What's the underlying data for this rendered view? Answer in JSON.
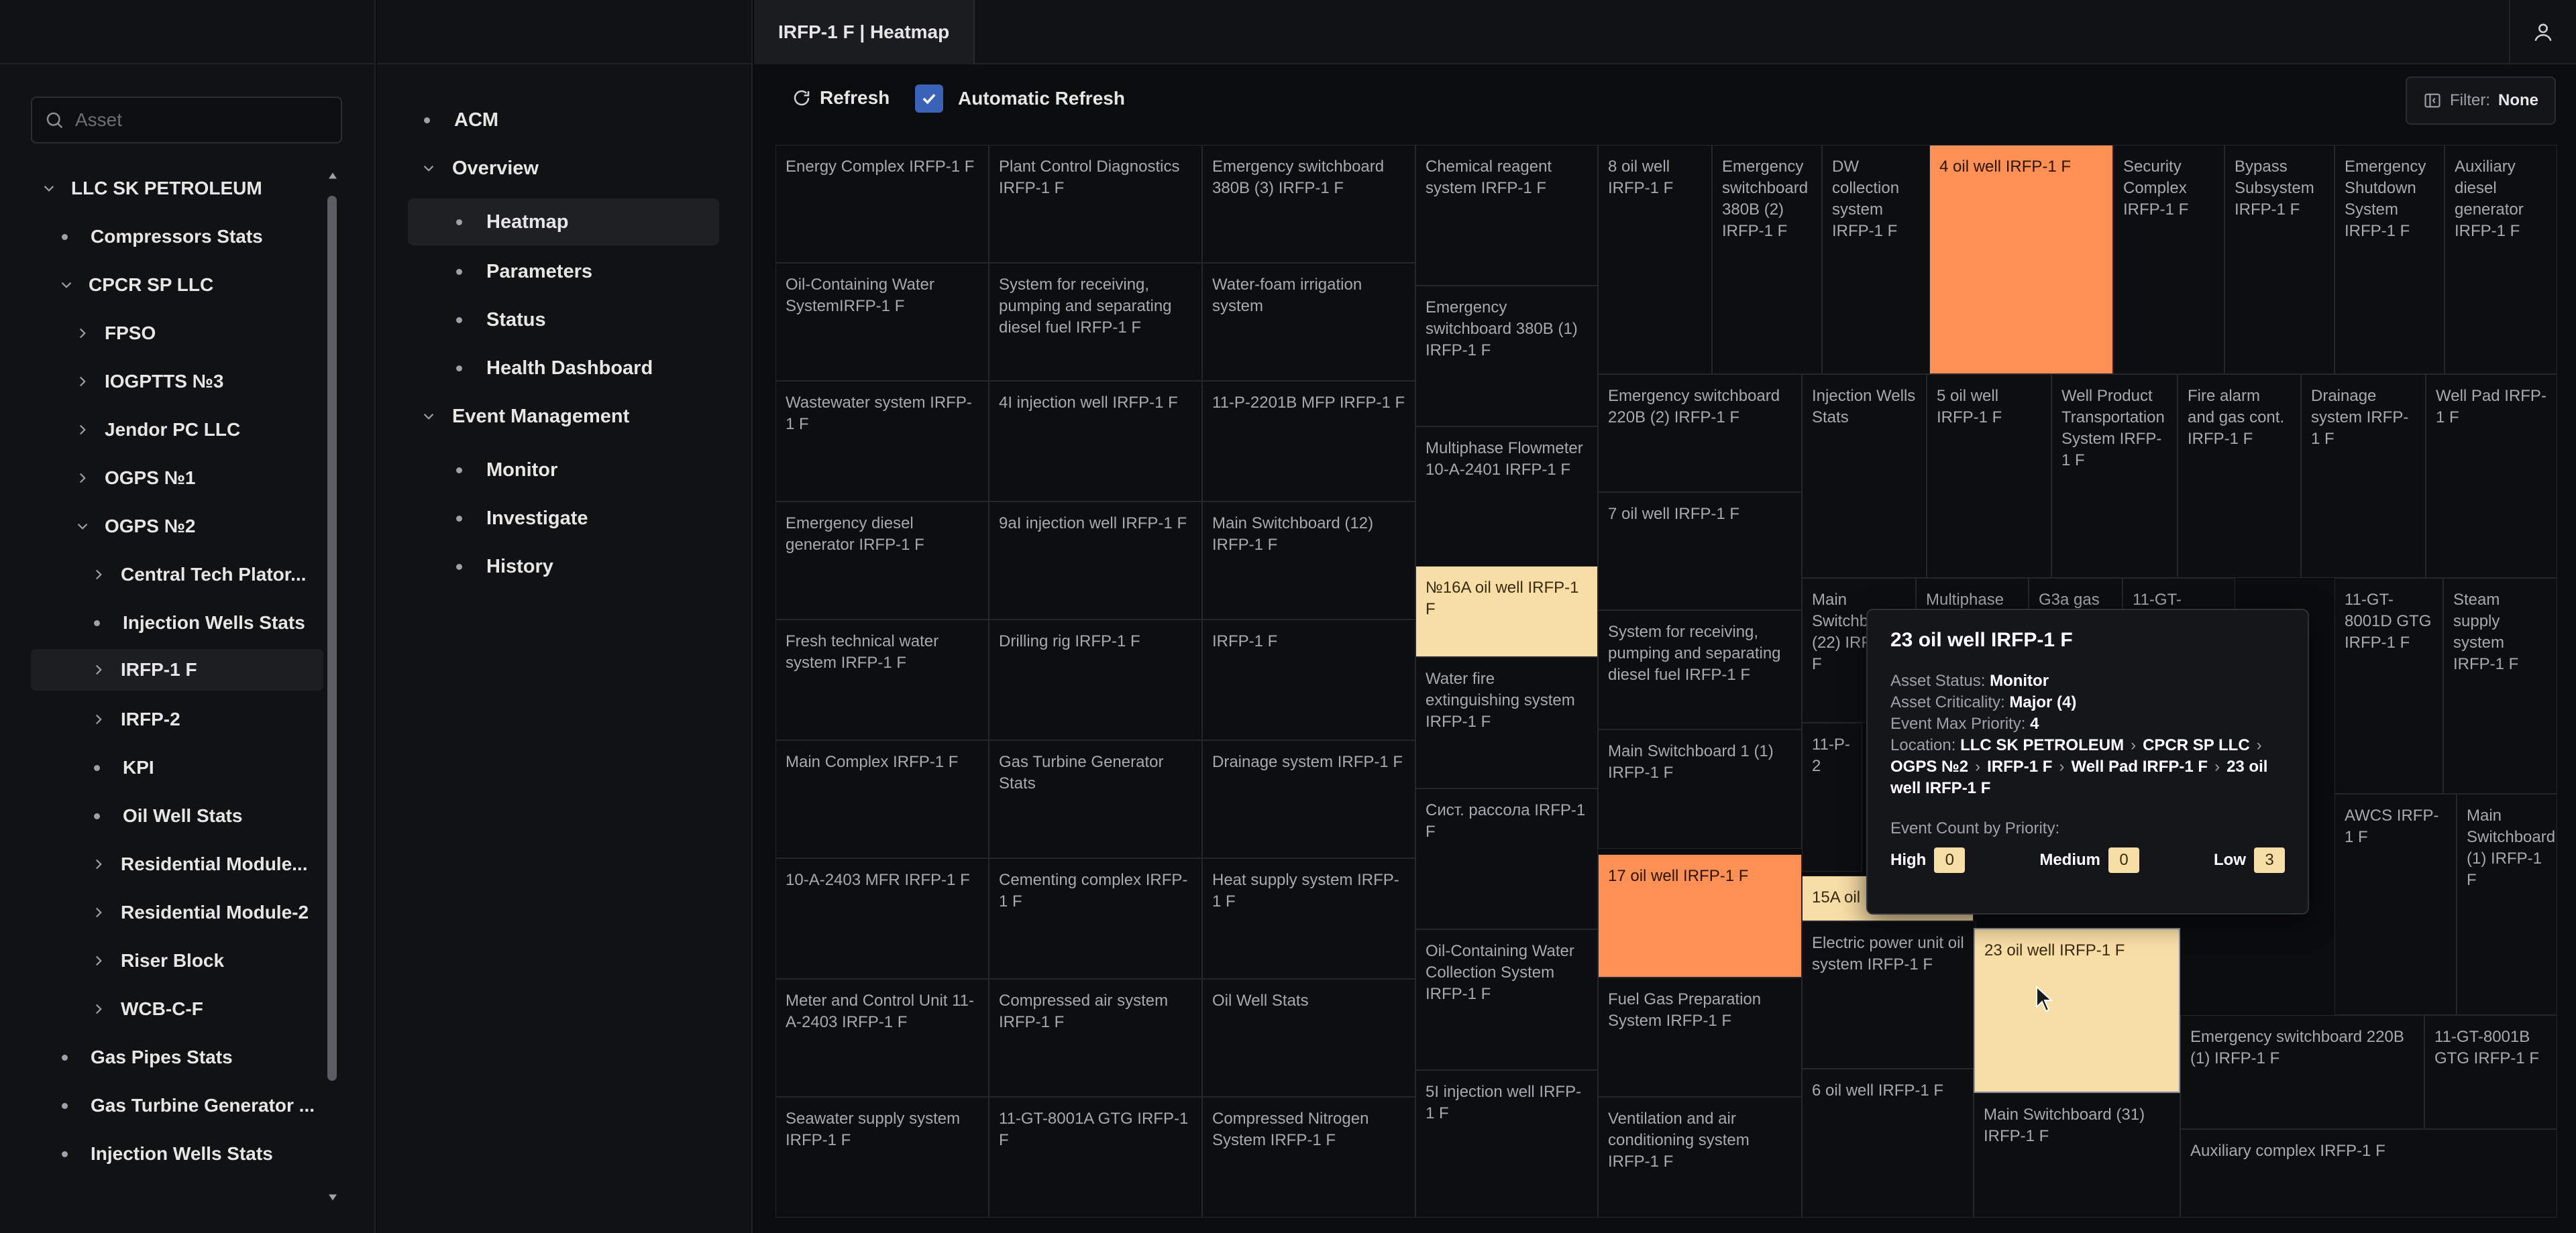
{
  "tree": {
    "search_placeholder": "Asset",
    "items": [
      {
        "label": "LLC SK PETROLEUM"
      },
      {
        "label": "Compressors Stats"
      },
      {
        "label": "CPCR SP LLC"
      },
      {
        "label": "FPSO"
      },
      {
        "label": "IOGPTTS №3"
      },
      {
        "label": "Jendor PC LLC"
      },
      {
        "label": "OGPS №1"
      },
      {
        "label": "OGPS №2"
      },
      {
        "label": "Central Tech Plator..."
      },
      {
        "label": "Injection Wells Stats"
      },
      {
        "label": "IRFP-1 F"
      },
      {
        "label": "IRFP-2"
      },
      {
        "label": "KPI"
      },
      {
        "label": "Oil Well Stats"
      },
      {
        "label": "Residential Module..."
      },
      {
        "label": "Residential Module-2"
      },
      {
        "label": "Riser Block"
      },
      {
        "label": "WCB-C-F"
      },
      {
        "label": "Gas Pipes Stats"
      },
      {
        "label": "Gas Turbine Generator ..."
      },
      {
        "label": "Injection Wells Stats"
      }
    ]
  },
  "nav": {
    "items": [
      {
        "label": "ACM"
      },
      {
        "label": "Overview"
      },
      {
        "label": "Heatmap"
      },
      {
        "label": "Parameters"
      },
      {
        "label": "Status"
      },
      {
        "label": "Health Dashboard"
      },
      {
        "label": "Event Management"
      },
      {
        "label": "Monitor"
      },
      {
        "label": "Investigate"
      },
      {
        "label": "History"
      }
    ]
  },
  "main": {
    "tab_title": "IRFP-1 F | Heatmap",
    "refresh_label": "Refresh",
    "auto_refresh_label": "Automatic Refresh",
    "filter_label": "Filter:",
    "filter_value": "None"
  },
  "colors": {
    "high": "#ff9055",
    "low": "#f7dda6",
    "accent": "#3a63b8"
  },
  "heatmap": {
    "cells": [
      {
        "label": "Energy Complex IRFP-1 F"
      },
      {
        "label": "Plant Control Diagnostics IRFP-1 F"
      },
      {
        "label": "Emergency switchboard 380B (3) IRFP-1 F"
      },
      {
        "label": "Oil-Containing Water SystemIRFP-1 F"
      },
      {
        "label": "System for receiving, pumping and separating diesel fuel IRFP-1 F"
      },
      {
        "label": "Water-foam irrigation system"
      },
      {
        "label": "Wastewater system IRFP-1 F"
      },
      {
        "label": "4I injection well IRFP-1 F"
      },
      {
        "label": "11-P-2201B MFP IRFP-1 F"
      },
      {
        "label": "Emergency diesel generator IRFP-1 F"
      },
      {
        "label": "9aI injection well IRFP-1 F"
      },
      {
        "label": "Main Switchboard (12) IRFP-1 F"
      },
      {
        "label": "Fresh technical water system IRFP-1 F"
      },
      {
        "label": "Drilling rig IRFP-1 F"
      },
      {
        "label": "IRFP-1 F"
      },
      {
        "label": "Main Complex IRFP-1 F"
      },
      {
        "label": "Gas Turbine Generator Stats"
      },
      {
        "label": "Drainage system IRFP-1 F"
      },
      {
        "label": "10-A-2403 MFR IRFP-1 F"
      },
      {
        "label": "Cementing complex IRFP-1 F"
      },
      {
        "label": "Heat supply system IRFP-1 F"
      },
      {
        "label": "Meter and Control Unit 11-A-2403 IRFP-1 F"
      },
      {
        "label": "Compressed air system IRFP-1 F"
      },
      {
        "label": "Oil Well Stats"
      },
      {
        "label": "Seawater supply system IRFP-1 F"
      },
      {
        "label": "11-GT-8001A GTG IRFP-1 F"
      },
      {
        "label": "Compressed Nitrogen System IRFP-1 F"
      },
      {
        "label": "Chemical reagent system IRFP-1 F"
      },
      {
        "label": "Emergency switchboard 380B (1) IRFP-1 F"
      },
      {
        "label": "Multiphase Flowmeter 10-A-2401 IRFP-1 F"
      },
      {
        "label": "№16A oil well IRFP-1 F"
      },
      {
        "label": "Water fire extinguishing system IRFP-1 F"
      },
      {
        "label": "Сист. рассола IRFP-1 F"
      },
      {
        "label": "Oil-Containing Water Collection System IRFP-1 F"
      },
      {
        "label": "5I injection well IRFP-1 F"
      },
      {
        "label": "8 oil well IRFP-1 F"
      },
      {
        "label": "Emergency switchboard 380B (2) IRFP-1 F"
      },
      {
        "label": "DW collection system IRFP-1 F"
      },
      {
        "label": "4 oil well IRFP-1 F"
      },
      {
        "label": "Security Complex IRFP-1 F"
      },
      {
        "label": "Bypass Subsystem IRFP-1 F"
      },
      {
        "label": "Emergency Shutdown System IRFP-1 F"
      },
      {
        "label": "Auxiliary diesel generator IRFP-1 F"
      },
      {
        "label": "Emergency switchboard 220B (2) IRFP-1 F"
      },
      {
        "label": "Injection Wells Stats"
      },
      {
        "label": "5 oil well IRFP-1 F"
      },
      {
        "label": "Well Product Transportation System IRFP-1 F"
      },
      {
        "label": "Fire alarm and gas cont. IRFP-1 F"
      },
      {
        "label": "Drainage system IRFP-1 F"
      },
      {
        "label": "Well Pad IRFP-1 F"
      },
      {
        "label": "7 oil well IRFP-1 F"
      },
      {
        "label": "System for receiving, pumping and separating diesel fuel IRFP-1 F"
      },
      {
        "label": "Main Switchboard (22) IRFP-1 F"
      },
      {
        "label": "Multiphase"
      },
      {
        "label": "G3a gas inj"
      },
      {
        "label": "11-GT-8001C"
      },
      {
        "label": "11-GT-8001D GTG IRFP-1 F"
      },
      {
        "label": "Steam supply system IRFP-1 F"
      },
      {
        "label": "Main Switchboard 1 (1) IRFP-1 F"
      },
      {
        "label": "11-P-2"
      },
      {
        "label": "AWCS IRFP-1 F"
      },
      {
        "label": "Main Switchboard (1) IRFP-1 F"
      },
      {
        "label": "17 oil well IRFP-1 F"
      },
      {
        "label": "15A oil"
      },
      {
        "label": "Electric power unit oil system IRFP-1 F"
      },
      {
        "label": "23 oil well IRFP-1 F"
      },
      {
        "label": "Fuel Gas Preparation System IRFP-1 F"
      },
      {
        "label": "Emergency switchboard 220B (1) IRFP-1 F"
      },
      {
        "label": "11-GT-8001B GTG IRFP-1 F"
      },
      {
        "label": "Ventilation and air conditioning system IRFP-1 F"
      },
      {
        "label": "6 oil well IRFP-1 F"
      },
      {
        "label": "Main Switchboard (31) IRFP-1 F"
      },
      {
        "label": "Auxiliary complex IRFP-1 F"
      }
    ]
  },
  "tooltip": {
    "title": "23 oil well IRFP-1 F",
    "asset_status_label": "Asset Status:",
    "asset_status": "Monitor",
    "asset_criticality_label": "Asset Criticality:",
    "asset_criticality": "Major (4)",
    "event_max_priority_label": "Event Max Priority:",
    "event_max_priority": "4",
    "location_label": "Location:",
    "location": [
      "LLC SK PETROLEUM",
      "CPCR SP LLC",
      "OGPS №2",
      "IRFP-1 F",
      "Well Pad IRFP-1 F",
      "23 oil well IRFP-1 F"
    ],
    "event_count_label": "Event Count by Priority:",
    "high_label": "High",
    "high_count": "0",
    "medium_label": "Medium",
    "medium_count": "0",
    "low_label": "Low",
    "low_count": "3"
  }
}
